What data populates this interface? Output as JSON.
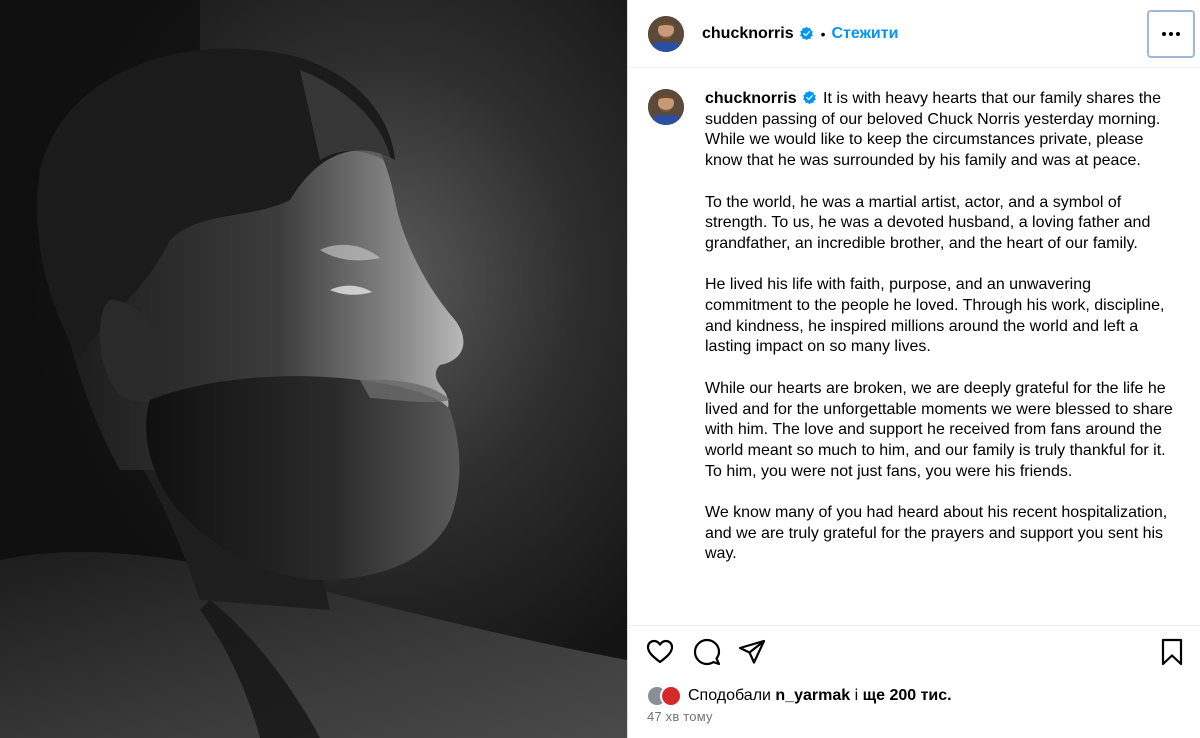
{
  "post": {
    "username": "chucknorris",
    "follow_label": "Стежити",
    "separator": "•",
    "caption_paragraphs": [
      "It is with heavy hearts that our family shares the sudden passing of our beloved Chuck Norris yesterday morning. While we would like to keep the circumstances private, please know that he was surrounded by his family and was at peace.",
      "To the world, he was a martial artist, actor, and a symbol of strength. To us, he was a devoted husband, a loving father and grandfather, an incredible brother, and the heart of our family.",
      "He lived his life with faith, purpose, and an unwavering commitment to the people he loved. Through his work, discipline, and kindness, he inspired millions around the world and left a lasting impact on so many lives.",
      "While our hearts are broken, we are deeply grateful for the life he lived and for the unforgettable moments we were blessed to share with him. The love and support he received from fans around the world meant so much to him, and our family is truly thankful for it. To him, you were not just fans, you were his friends.",
      "We know many of you had heard about his recent hospitalization, and we are truly grateful for the prayers and support you sent his way."
    ]
  },
  "likes": {
    "prefix": "Сподобали",
    "user": "n_yarmak",
    "suffix_connector": "і",
    "suffix_count": "ще 200 тис."
  },
  "timestamp": "47 хв тому",
  "icons": {
    "verified": "verified-badge-icon",
    "more": "more-options-icon",
    "like": "heart-icon",
    "comment": "comment-icon",
    "share": "share-icon",
    "save": "bookmark-icon"
  },
  "colors": {
    "accent": "#0095f6",
    "muted": "#737373"
  }
}
